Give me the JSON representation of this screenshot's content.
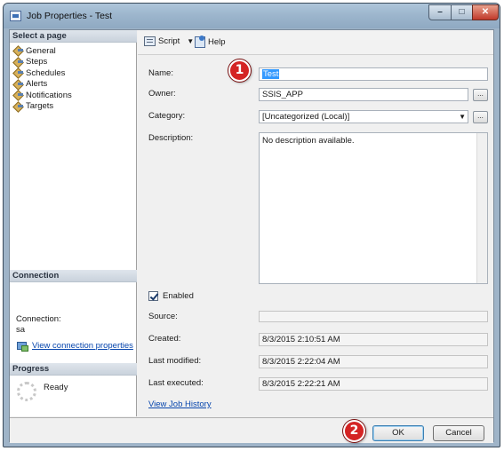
{
  "window": {
    "title": "Job Properties - Test",
    "controls": {
      "minimize": "–",
      "maximize": "□",
      "close": "✕"
    }
  },
  "left_panel": {
    "select_page_header": "Select a page",
    "pages": [
      {
        "label": "General",
        "icon": "wrench-icon"
      },
      {
        "label": "Steps",
        "icon": "wrench-icon"
      },
      {
        "label": "Schedules",
        "icon": "wrench-icon"
      },
      {
        "label": "Alerts",
        "icon": "wrench-icon"
      },
      {
        "label": "Notifications",
        "icon": "wrench-icon"
      },
      {
        "label": "Targets",
        "icon": "wrench-icon"
      }
    ],
    "connection_header": "Connection",
    "connection_label": "Connection:",
    "connection_value": "sa",
    "connection_link": "View connection properties",
    "progress_header": "Progress",
    "progress_status": "Ready"
  },
  "toolbar": {
    "script_label": "Script",
    "script_caret": "▼",
    "help_label": "Help"
  },
  "form": {
    "name_label": "Name:",
    "name_value": "Test",
    "owner_label": "Owner:",
    "owner_value": "SSIS_APP",
    "category_label": "Category:",
    "category_value": "[Uncategorized (Local)]",
    "description_label": "Description:",
    "description_value": "No description available.",
    "enabled_label": "Enabled",
    "enabled_checked": true,
    "source_label": "Source:",
    "source_value": "",
    "created_label": "Created:",
    "created_value": "8/3/2015 2:10:51 AM",
    "last_modified_label": "Last modified:",
    "last_modified_value": "8/3/2015 2:22:04 AM",
    "last_executed_label": "Last executed:",
    "last_executed_value": "8/3/2015 2:22:21 AM",
    "history_link": "View Job History",
    "browse_label": "...",
    "combo_caret": "▼"
  },
  "footer": {
    "ok_label": "OK",
    "cancel_label": "Cancel"
  },
  "annotations": {
    "marker_1": "1",
    "marker_2": "2"
  },
  "colors": {
    "annotation_red": "#d42323",
    "link_blue": "#0645ad",
    "selection_blue": "#3399ff"
  }
}
